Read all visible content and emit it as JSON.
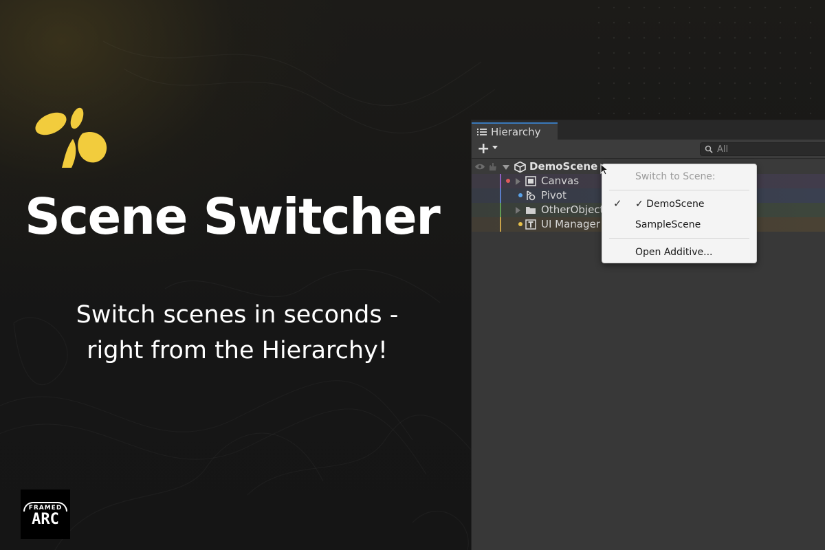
{
  "promo": {
    "title": "Scene Switcher",
    "subtitle_line1": "Switch scenes in seconds -",
    "subtitle_line2": "right from the Hierarchy!",
    "badge_top": "FRAMED",
    "badge_main": "ARC",
    "accent_color": "#f2cc3d"
  },
  "hierarchy": {
    "tab_label": "Hierarchy",
    "add_label": "+",
    "search_placeholder": "All",
    "scene_name": "DemoScene",
    "objects": [
      {
        "label": "Canvas",
        "dot_color": "#e05a5a",
        "stripe_color": "#8f5fbf",
        "icon": "canvas-icon"
      },
      {
        "label": "Pivot",
        "dot_color": "#5aa2e8",
        "stripe_color": "#5b7ec8",
        "icon": "pivot-icon"
      },
      {
        "label": "OtherObjects",
        "dot_color": "",
        "stripe_color": "#5f9a55",
        "icon": "folder-icon"
      },
      {
        "label": "UI Manager",
        "dot_color": "#e8c14a",
        "stripe_color": "#c9a24a",
        "icon": "text-icon"
      }
    ]
  },
  "scene_menu": {
    "header": "Switch to Scene:",
    "items": [
      {
        "label": "✓ DemoScene",
        "checked": true
      },
      {
        "label": "SampleScene",
        "checked": false
      }
    ],
    "footer_item": "Open Additive..."
  }
}
